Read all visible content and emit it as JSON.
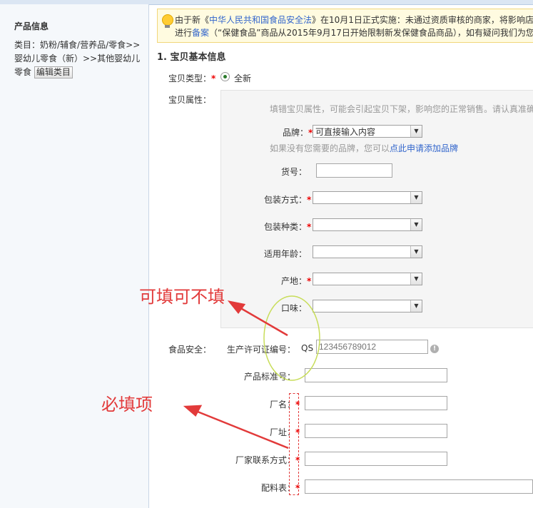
{
  "sidebar": {
    "title": "产品信息",
    "category_prefix": "类目：",
    "category_path": "奶粉/辅食/营养品/零食>>婴幼儿零食（新）>>其他婴幼儿零食",
    "edit_category_button": "编辑类目"
  },
  "notice": {
    "line1_pre": "由于新《",
    "line1_link": "中华人民共和国食品安全法",
    "line1_post": "》在10月1日正式实施：未通过资质审核的商家，将影响店铺",
    "line2_pre": "进行",
    "line2_link": "备案",
    "line2_post": "（“保健食品”商品从2015年9月17日开始限制新发保健食品商品），如有疑问我们为您"
  },
  "section": {
    "title": "1. 宝贝基本信息"
  },
  "item_type": {
    "label": "宝贝类型：",
    "required": "*",
    "option": "全新"
  },
  "item_attrs": {
    "label": "宝贝属性：",
    "hint": "填错宝贝属性，可能会引起宝贝下架，影响您的正常销售。请认真准确",
    "brand": {
      "label": "品牌：",
      "required": "*",
      "value": "可直接输入内容"
    },
    "brand_help_pre": "如果没有您需要的品牌，您可以",
    "brand_help_link": "点此申请添加品牌",
    "sku": {
      "label": "货号：",
      "value": ""
    },
    "packaging_method": {
      "label": "包装方式：",
      "required": "*",
      "value": ""
    },
    "package_type": {
      "label": "包装种类：",
      "required": "*",
      "value": ""
    },
    "age_range": {
      "label": "适用年龄：",
      "value": ""
    },
    "origin": {
      "label": "产地：",
      "required": "*",
      "value": ""
    },
    "flavor": {
      "label": "口味：",
      "value": ""
    }
  },
  "food_safety": {
    "label": "食品安全：",
    "license": {
      "label": "生产许可证编号：",
      "prefix": "QS",
      "placeholder": "123456789012"
    },
    "standard_no": {
      "label": "产品标准号：",
      "value": ""
    },
    "factory_name": {
      "label": "厂名：",
      "required": "*",
      "value": ""
    },
    "factory_address": {
      "label": "厂址：",
      "required": "*",
      "value": ""
    },
    "factory_contact": {
      "label": "厂家联系方式：",
      "required": "*",
      "value": ""
    },
    "ingredients": {
      "label": "配料表：",
      "required": "*",
      "value": ""
    }
  },
  "annotations": {
    "optional": "可填可不填",
    "required": "必填项"
  },
  "colors": {
    "annotation_red": "#e23a3a",
    "ellipse_green": "#c8dd5a",
    "link_blue": "#3366cc"
  },
  "icons": [
    "bulb-icon",
    "radio-selected-icon",
    "dropdown-arrow-icon",
    "info-icon"
  ]
}
